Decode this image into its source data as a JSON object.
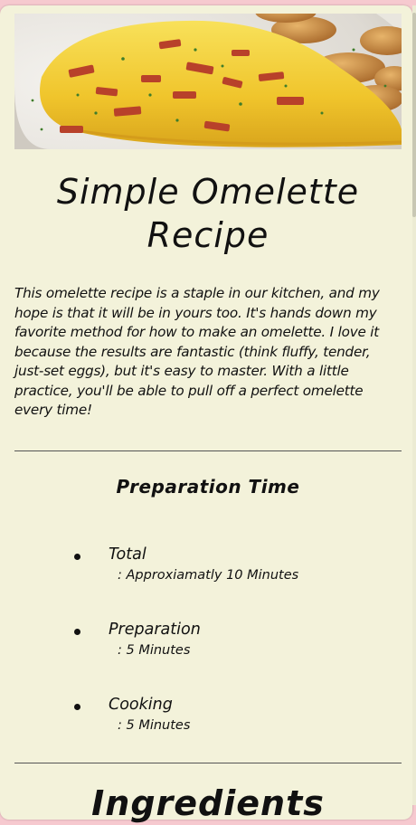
{
  "recipe": {
    "title": "Simple Omelette Recipe",
    "intro": "This omelette recipe is a staple in our kitchen, and my hope is that it will be in yours too. It's hands down my favorite method for how to make an omelette. I love it because the results are fantastic (think fluffy, tender, just-set eggs), but it's easy to master. With a little practice, you'll be able to pull off a perfect omelette every time!"
  },
  "preparation": {
    "heading": "Preparation Time",
    "items": [
      {
        "label": "Total",
        "value": ": Approxiamatly 10 Minutes"
      },
      {
        "label": "Preparation",
        "value": ": 5 Minutes"
      },
      {
        "label": "Cooking",
        "value": ": 5 Minutes"
      }
    ]
  },
  "ingredients": {
    "heading": "Ingredients"
  },
  "colors": {
    "page_background": "#f6c9cf",
    "card_background": "#f3f2da",
    "text": "#111111",
    "omelette": "#f3cf39",
    "bacon": "#b8412a"
  }
}
